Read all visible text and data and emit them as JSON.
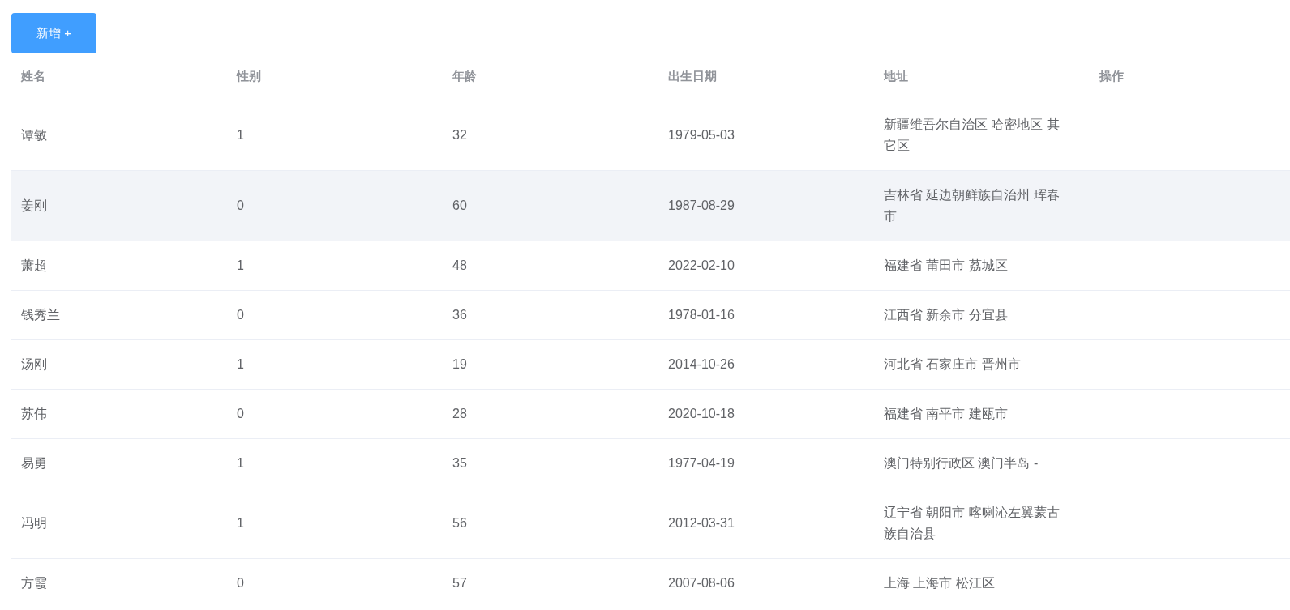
{
  "add_button": {
    "label": "新增 +"
  },
  "table": {
    "columns": [
      "姓名",
      "性别",
      "年龄",
      "出生日期",
      "地址",
      "操作"
    ],
    "rows": [
      {
        "highlighted": false,
        "cells": [
          "谭敏",
          "1",
          "32",
          "1979-05-03",
          "新疆维吾尔自治区 哈密地区 其它区"
        ]
      },
      {
        "highlighted": true,
        "cells": [
          "姜刚",
          "0",
          "60",
          "1987-08-29",
          "吉林省 延边朝鲜族自治州 珲春市"
        ]
      },
      {
        "highlighted": false,
        "cells": [
          "萧超",
          "1",
          "48",
          "2022-02-10",
          "福建省 莆田市 荔城区"
        ]
      },
      {
        "highlighted": false,
        "cells": [
          "钱秀兰",
          "0",
          "36",
          "1978-01-16",
          "江西省 新余市 分宜县"
        ]
      },
      {
        "highlighted": false,
        "cells": [
          "汤刚",
          "1",
          "19",
          "2014-10-26",
          "河北省 石家庄市 晋州市"
        ]
      },
      {
        "highlighted": false,
        "cells": [
          "苏伟",
          "0",
          "28",
          "2020-10-18",
          "福建省 南平市 建瓯市"
        ]
      },
      {
        "highlighted": false,
        "cells": [
          "易勇",
          "1",
          "35",
          "1977-04-19",
          "澳门特别行政区 澳门半岛 -"
        ]
      },
      {
        "highlighted": false,
        "cells": [
          "冯明",
          "1",
          "56",
          "2012-03-31",
          "辽宁省 朝阳市 喀喇沁左翼蒙古族自治县"
        ]
      },
      {
        "highlighted": false,
        "cells": [
          "方霞",
          "0",
          "57",
          "2007-08-06",
          "上海 上海市 松江区"
        ]
      }
    ]
  }
}
